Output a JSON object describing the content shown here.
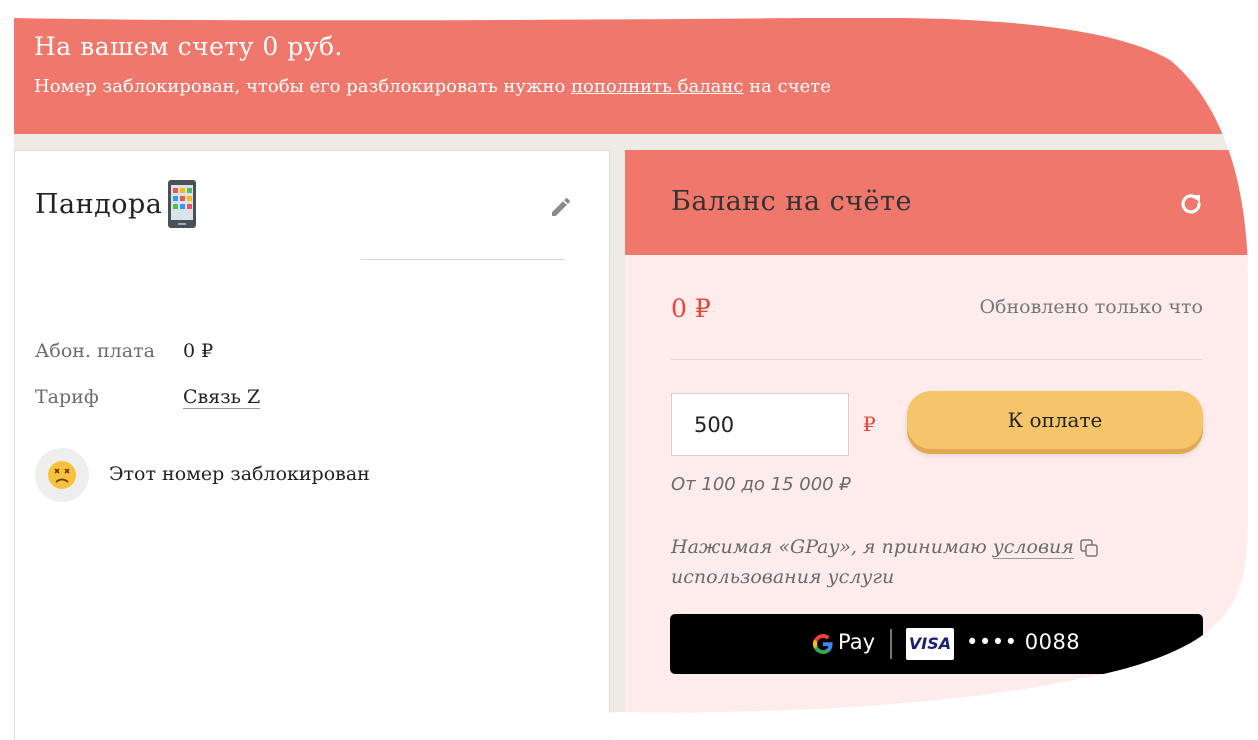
{
  "alert": {
    "title": "На вашем счету 0 руб.",
    "message_before": "Номер заблокирован, чтобы его разблокировать нужно ",
    "link": "пополнить баланс",
    "message_after": " на счете"
  },
  "number_card": {
    "name": "Пандора",
    "phone_icon": "phone-icon",
    "edit_icon": "pencil-icon",
    "fee_label": "Абон. плата",
    "fee_value": "0 ₽",
    "tariff_label": "Тариф",
    "tariff_value": "Связь Z",
    "status_icon": "sad-face-icon",
    "status_text": "Этот номер заблокирован"
  },
  "balance_card": {
    "title": "Баланс на счёте",
    "refresh_icon": "refresh-icon",
    "amount": "0 ₽",
    "updated": "Обновлено только что",
    "input_value": "500",
    "currency": "₽",
    "pay_button": "К оплате",
    "range_hint": "От 100 до 15 000 ₽",
    "terms_before": "Нажимая «GPay», я принимаю",
    "terms_link": "условия",
    "terms_after": "использования услуги",
    "gpay_label": "Pay",
    "card_brand": "VISA",
    "card_number": "•••• 0088"
  },
  "colors": {
    "accent": "#f0776b",
    "panel_pink": "#fdeceb",
    "pay_button": "#f6c46a",
    "amount_red": "#e8453c"
  }
}
